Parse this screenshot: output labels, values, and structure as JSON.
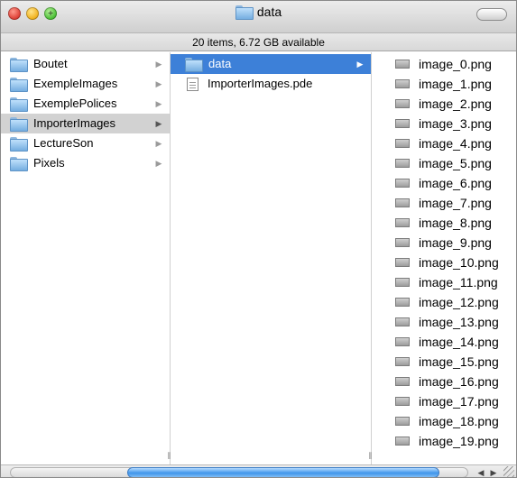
{
  "window": {
    "title": "data",
    "status": "20 items, 6.72 GB available"
  },
  "column1": {
    "items": [
      {
        "label": "Boutet"
      },
      {
        "label": "ExempleImages"
      },
      {
        "label": "ExemplePolices"
      },
      {
        "label": "ImporterImages"
      },
      {
        "label": "LectureSon"
      },
      {
        "label": "Pixels"
      }
    ]
  },
  "column2": {
    "items": [
      {
        "label": "data"
      },
      {
        "label": "ImporterImages.pde"
      }
    ]
  },
  "column3": {
    "items": [
      {
        "label": "image_0.png"
      },
      {
        "label": "image_1.png"
      },
      {
        "label": "image_2.png"
      },
      {
        "label": "image_3.png"
      },
      {
        "label": "image_4.png"
      },
      {
        "label": "image_5.png"
      },
      {
        "label": "image_6.png"
      },
      {
        "label": "image_7.png"
      },
      {
        "label": "image_8.png"
      },
      {
        "label": "image_9.png"
      },
      {
        "label": "image_10.png"
      },
      {
        "label": "image_11.png"
      },
      {
        "label": "image_12.png"
      },
      {
        "label": "image_13.png"
      },
      {
        "label": "image_14.png"
      },
      {
        "label": "image_15.png"
      },
      {
        "label": "image_16.png"
      },
      {
        "label": "image_17.png"
      },
      {
        "label": "image_18.png"
      },
      {
        "label": "image_19.png"
      }
    ]
  },
  "icons": {
    "arrow": "▶",
    "resize_handle": "⦀",
    "scroll_left": "◀",
    "scroll_right": "▶",
    "zoom_plus": "+"
  },
  "colors": {
    "selection_blue": "#3d80d8",
    "selection_gray": "#d2d2d2"
  }
}
